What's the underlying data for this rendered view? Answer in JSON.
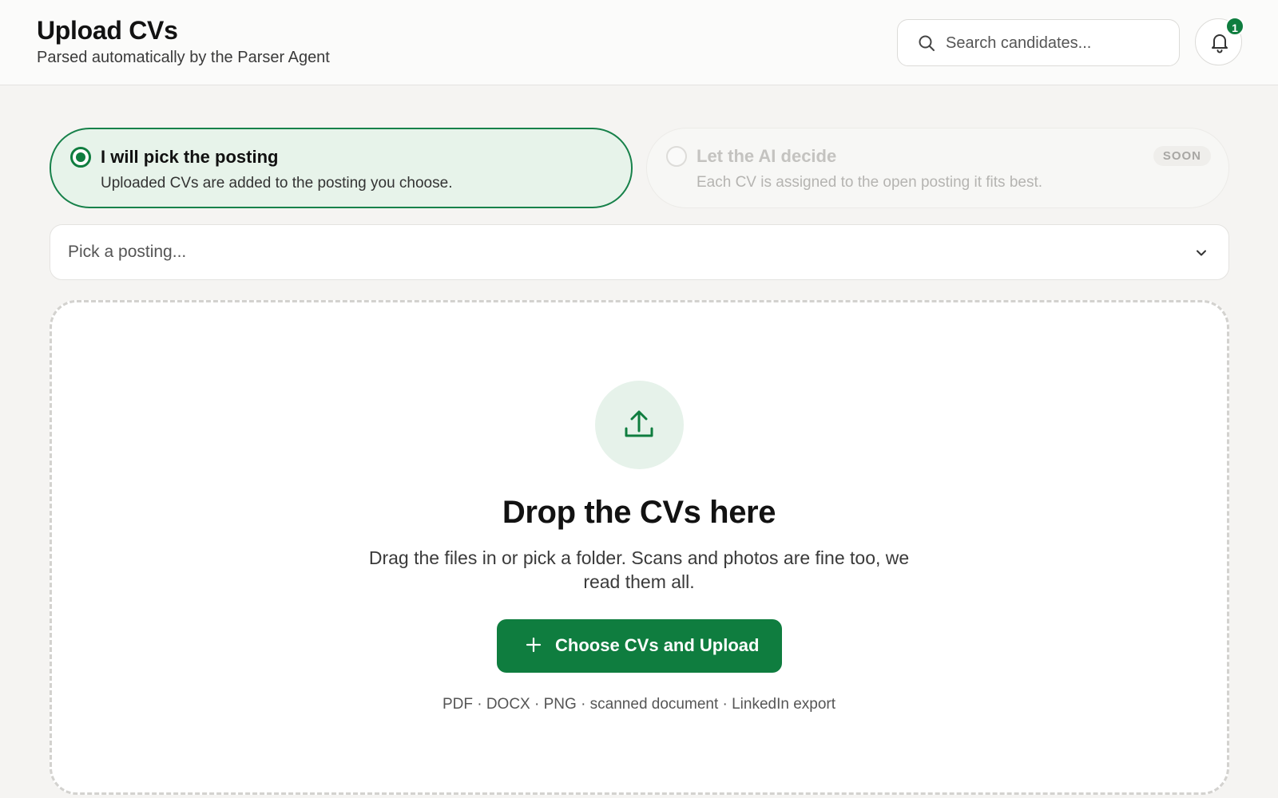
{
  "header": {
    "title": "Upload CVs",
    "subtitle": "Parsed automatically by the Parser Agent",
    "search": {
      "placeholder": "Search candidates..."
    },
    "notifications": {
      "count": "1"
    }
  },
  "options": {
    "manual": {
      "title": "I will pick the posting",
      "description": "Uploaded CVs are added to the posting you choose.",
      "selected": true
    },
    "ai": {
      "title": "Let the AI decide",
      "description": "Each CV is assigned to the open posting it fits best.",
      "badge": "SOON",
      "selected": false
    }
  },
  "posting_select": {
    "placeholder": "Pick a posting..."
  },
  "dropzone": {
    "title": "Drop the CVs here",
    "description": "Drag the files in or pick a folder. Scans and photos are fine too, we read them all.",
    "button_label": "Choose CVs and Upload",
    "formats": "PDF · DOCX · PNG · scanned document · LinkedIn export"
  },
  "colors": {
    "accent": "#0f7d3f",
    "accent_light": "#e7f3ea",
    "background": "#f5f4f2"
  }
}
